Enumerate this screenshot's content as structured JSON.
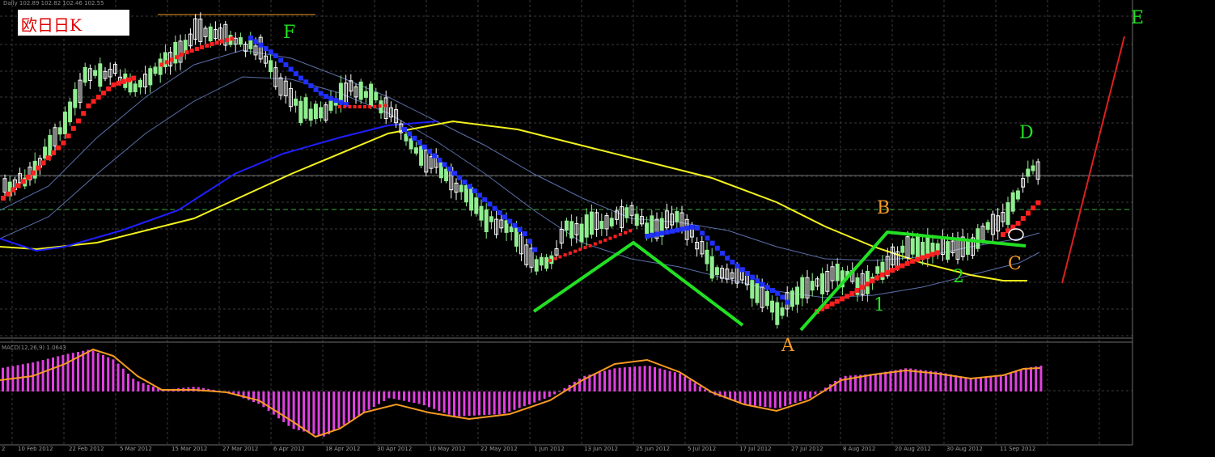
{
  "title": "欧日日K",
  "header_info": "Daily  102.89 102.82 102.46 102.55",
  "macd_info": "MACD(12,26,9) 1.0643",
  "wave_labels": {
    "F": "F",
    "A": "A",
    "B": "B",
    "C": "C",
    "D": "D",
    "E": "E",
    "one": "1",
    "two": "2"
  },
  "colors": {
    "background": "#000000",
    "bull_candle": "#ffffff",
    "bear_candle": "#90ee90",
    "ema_blue": "#1f1fff",
    "ema_yellow": "#f2f21d",
    "envelope": "#5b6fa8",
    "sar_red": "#ff2020",
    "sar_blue": "#2030ff",
    "wave_green": "#22e022",
    "forecast_red": "#dd1f1f",
    "macd_hist": "#e040e0",
    "macd_signal": "#f59a23",
    "label_green": "#22e022",
    "label_orange": "#f59a23"
  },
  "chart_data": {
    "type": "candlestick",
    "instrument": "EURJPY",
    "timeframe": "Daily",
    "x_tick_labels": [
      "2",
      "10 Feb 2012",
      "22 Feb 2012",
      "5 Mar 2012",
      "15 Mar 2012",
      "27 Mar 2012",
      "6 Apr 2012",
      "18 Apr 2012",
      "30 Apr 2012",
      "10 May 2012",
      "22 May 2012",
      "1 Jun 2012",
      "13 Jun 2012",
      "25 Jun 2012",
      "5 Jul 2012",
      "17 Jul 2012",
      "27 Jul 2012",
      "8 Aug 2012",
      "20 Aug 2012",
      "30 Aug 2012",
      "11 Sep 2012"
    ],
    "price_range_approx": [
      94,
      112
    ],
    "close_path": [
      104.0,
      105.0,
      106.5,
      108.0,
      110.0,
      109.0,
      110.5,
      109.5,
      108.5,
      109.0,
      110.5,
      111.0,
      111.5,
      111.2,
      110.0,
      109.0,
      108.5,
      109.0,
      108.0,
      108.5,
      107.5,
      106.0,
      104.5,
      103.0,
      101.5,
      100.0,
      98.0,
      99.0,
      100.0,
      101.0,
      100.0,
      101.0,
      99.5,
      98.0,
      97.5,
      96.5,
      95.5,
      96.5,
      97.5,
      98.5,
      98.0,
      98.3,
      99.0,
      98.5,
      99.0,
      101.5,
      102.5
    ],
    "legend": false,
    "grid": true
  }
}
